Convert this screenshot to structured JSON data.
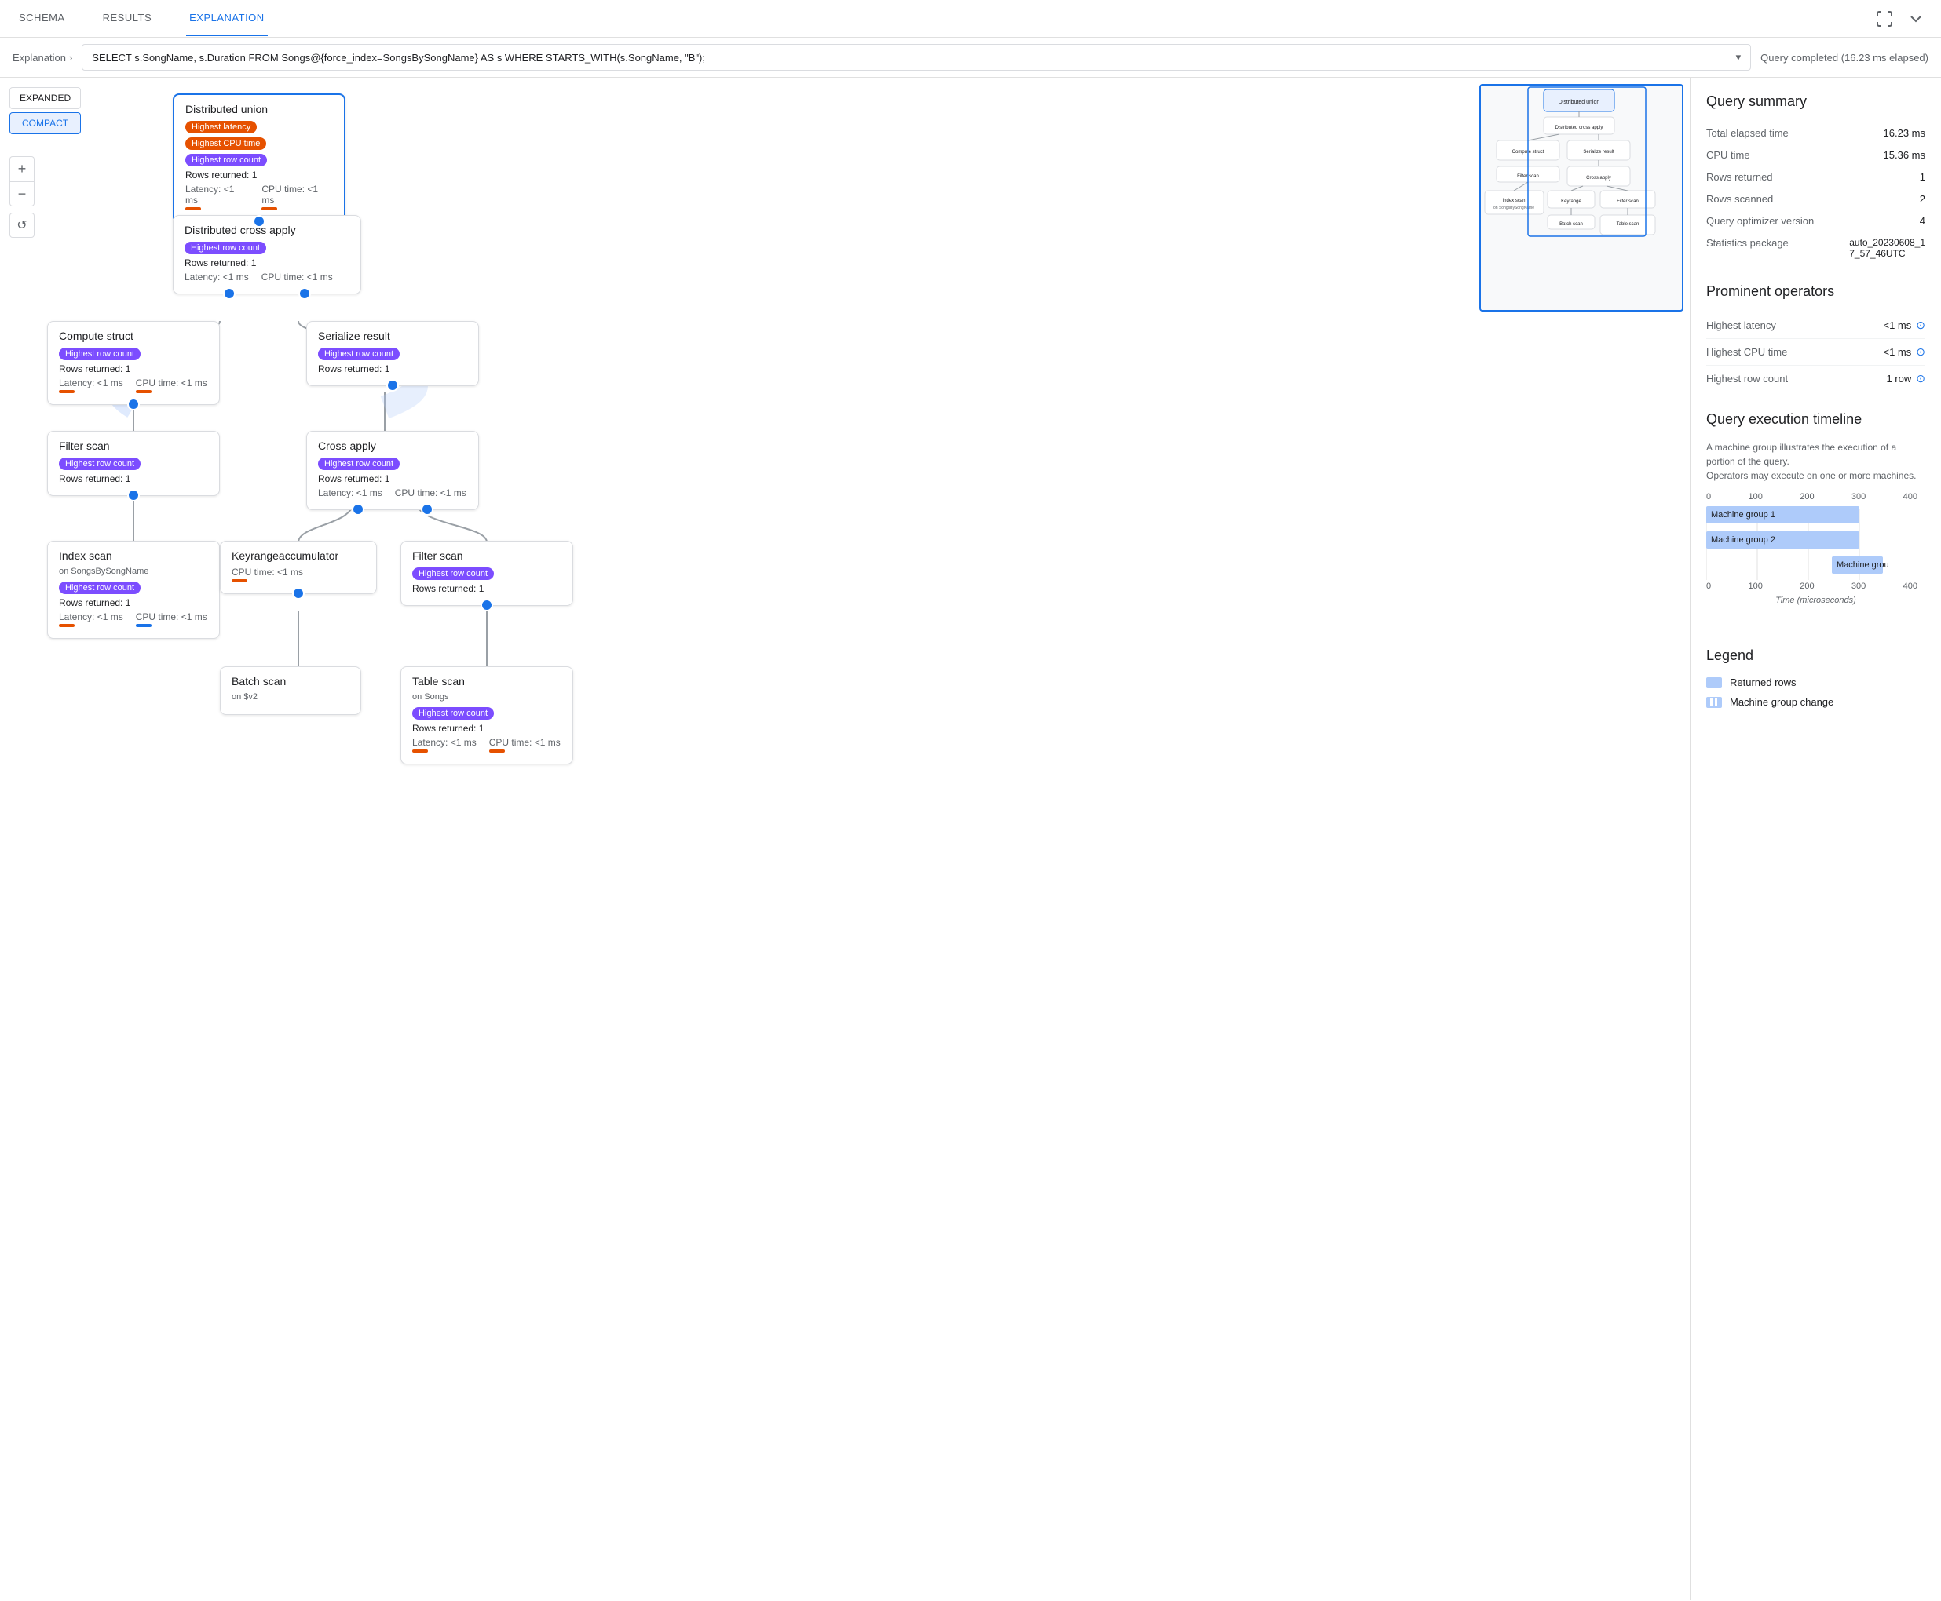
{
  "tabs": [
    {
      "id": "schema",
      "label": "SCHEMA",
      "active": false
    },
    {
      "id": "results",
      "label": "RESULTS",
      "active": false
    },
    {
      "id": "explanation",
      "label": "EXPLANATION",
      "active": true
    }
  ],
  "query_bar": {
    "breadcrumb": "Explanation",
    "query_text": "SELECT s.SongName, s.Duration FROM Songs@{force_index=SongsBySongName} AS s WHERE STARTS_WITH(s.SongName, \"B\");",
    "status": "Query completed (16.23 ms elapsed)"
  },
  "view_controls": {
    "expanded": "EXPANDED",
    "compact": "COMPACT",
    "active": "compact"
  },
  "zoom": {
    "plus": "+",
    "minus": "−",
    "reset": "↺"
  },
  "nodes": {
    "distributed_union": {
      "title": "Distributed union",
      "badges": [
        "Highest latency",
        "Highest CPU time",
        "Highest row count"
      ],
      "rows": "Rows returned: 1",
      "latency": "Latency: <1 ms",
      "cpu": "CPU time: <1 ms"
    },
    "distributed_cross": {
      "title": "Distributed cross apply",
      "badges": [
        "Highest row count"
      ],
      "rows": "Rows returned: 1",
      "latency": "Latency: <1 ms",
      "cpu": "CPU time: <1 ms"
    },
    "compute_struct": {
      "title": "Compute struct",
      "badges": [
        "Highest row count"
      ],
      "rows": "Rows returned: 1",
      "latency": "Latency: <1 ms",
      "cpu": "CPU time: <1 ms"
    },
    "serialize_result": {
      "title": "Serialize result",
      "badges": [
        "Highest row count"
      ],
      "rows": "Rows returned: 1"
    },
    "filter_scan_1": {
      "title": "Filter scan",
      "badges": [
        "Highest row count"
      ],
      "rows": "Rows returned: 1"
    },
    "cross_apply": {
      "title": "Cross apply",
      "badges": [
        "Highest row count"
      ],
      "rows": "Rows returned: 1",
      "latency": "Latency: <1 ms",
      "cpu": "CPU time: <1 ms"
    },
    "index_scan": {
      "title": "Index scan",
      "subtitle": "on SongsBySongName",
      "badges": [
        "Highest row count"
      ],
      "rows": "Rows returned: 1",
      "latency": "Latency: <1 ms",
      "cpu": "CPU time: <1 ms"
    },
    "keyrange": {
      "title": "Keyrangeaccumulator",
      "cpu": "CPU time: <1 ms"
    },
    "filter_scan_2": {
      "title": "Filter scan",
      "badges": [
        "Highest row count"
      ],
      "rows": "Rows returned: 1"
    },
    "batch_scan": {
      "title": "Batch scan",
      "subtitle": "on $v2"
    },
    "table_scan": {
      "title": "Table scan",
      "subtitle": "on Songs",
      "badges": [
        "Highest row count"
      ],
      "rows": "Rows returned: 1",
      "latency": "Latency: <1 ms",
      "cpu": "CPU time: <1 ms"
    }
  },
  "query_summary": {
    "title": "Query summary",
    "rows": [
      {
        "label": "Total elapsed time",
        "value": "16.23 ms"
      },
      {
        "label": "CPU time",
        "value": "15.36 ms"
      },
      {
        "label": "Rows returned",
        "value": "1"
      },
      {
        "label": "Rows scanned",
        "value": "2"
      },
      {
        "label": "Query optimizer version",
        "value": "4"
      },
      {
        "label": "Statistics package",
        "value": "auto_20230608_17_57_46UTC"
      }
    ]
  },
  "prominent_operators": {
    "title": "Prominent operators",
    "rows": [
      {
        "label": "Highest latency",
        "value": "<1 ms"
      },
      {
        "label": "Highest CPU time",
        "value": "<1 ms"
      },
      {
        "label": "Highest row count",
        "value": "1 row"
      }
    ]
  },
  "timeline": {
    "title": "Query execution timeline",
    "description": "A machine group illustrates the execution of a portion of the query.\nOperators may execute on one or more machines.",
    "axis_labels": [
      "0",
      "100",
      "200",
      "300",
      "400"
    ],
    "bars": [
      {
        "label": "Machine group 1",
        "start": 0,
        "width": 75,
        "color": "#aecbfa"
      },
      {
        "label": "Machine group 2",
        "start": 0,
        "width": 75,
        "color": "#aecbfa"
      },
      {
        "label": "Machine grou",
        "start": 62,
        "width": 25,
        "color": "#aecbfa"
      }
    ],
    "x_label": "Time (microseconds)"
  },
  "legend": {
    "title": "Legend",
    "items": [
      {
        "type": "rows",
        "label": "Returned rows"
      },
      {
        "type": "machine",
        "label": "Machine group change"
      }
    ]
  }
}
